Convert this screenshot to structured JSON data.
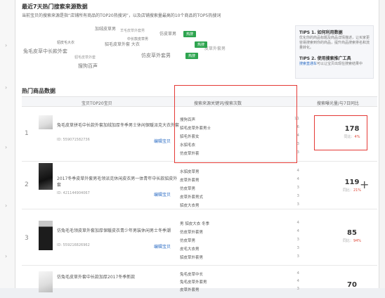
{
  "section1": {
    "title": "最近7天热门搜索来源数据",
    "desc": "当前宝贝的搜索来源是指“店铺所有商品的TOP20热搜词”，以及店铺搜索量最高的10个商品的TOP5热搜词"
  },
  "cloud_words": [
    {
      "text": "加绒皮草男",
      "size": 6
    },
    {
      "text": "貂皮毛大衣",
      "size": 5
    },
    {
      "text": "中长款皮草男",
      "size": 5
    },
    {
      "text": "貂毛皮草外套 大衣",
      "size": 6
    },
    {
      "text": "仿皮草男",
      "size": 6
    },
    {
      "text": "兔毛皮草中长款外套",
      "size": 7
    },
    {
      "text": "仿皮草外套男",
      "size": 7
    },
    {
      "text": "羊毛皮草外套男",
      "size": 6
    },
    {
      "text": "皮草外套男",
      "size": 6
    },
    {
      "text": "貂毛皮草外套",
      "size": 5
    },
    {
      "text": "搜狗百声",
      "size": 7
    }
  ],
  "cloud_tags": [
    "热搜",
    "热搜",
    "热搜"
  ],
  "tips": {
    "t1": "TIPS 1. 如何利用数据",
    "d1": "优化你的商品标题及商品详情描述，让买家更容易搜索到你的商品，提升商品搜索排名和流量转化。",
    "t2": "TIPS 2. 使用搜索推广工具",
    "d2_link": "搜索直通车",
    "d2": "可以让宝贝出现在搜索结果中"
  },
  "section2": {
    "title": "热门商品数据"
  },
  "table_headers": {
    "col1": "宝贝TOP20宝贝",
    "col2": "搜索来源关键词/搜索次数",
    "col3": "搜索曝光量/与7日同比"
  },
  "rows": [
    {
      "rank": "1",
      "title": "兔毛皮草拼毛中长款外套加绒加厚冬季男士休闲保暖派克大衣外套",
      "id": "ID: 559071582736",
      "link": "编辑宝贝",
      "keywords": [
        {
          "k": "搜狗百声",
          "c": "11"
        },
        {
          "k": "貂毛皮草外套男士",
          "c": "6"
        },
        {
          "k": "貂毛外套女",
          "c": "4"
        },
        {
          "k": "水貂毛衣",
          "c": "3"
        },
        {
          "k": "仿皮草外套",
          "c": "3"
        }
      ],
      "value": "178",
      "ratio_label": "同比：",
      "ratio": "4%"
    },
    {
      "rank": "2",
      "title": "2017冬季皮草外套男毛领派克休闲皮衣男一体青年中长款貂皮外套",
      "id": "ID: 421144904067",
      "link": "编辑宝贝",
      "keywords": [
        {
          "k": "水貂皮草男",
          "c": "4"
        },
        {
          "k": "皮草外套男",
          "c": "4"
        },
        {
          "k": "仿皮草男",
          "c": "3"
        },
        {
          "k": "皮草外套男式",
          "c": "3"
        },
        {
          "k": "貂皮大衣男",
          "c": "3"
        }
      ],
      "value": "119",
      "ratio_label": "同比：",
      "ratio": "21%"
    },
    {
      "rank": "3",
      "title": "仿兔毛毛领皮草外套加厚保暖皮衣青少年男装休闲男士冬季潮",
      "id": "ID: 559216826962",
      "link": "编辑宝贝",
      "keywords": [
        {
          "k": "男 貂皮大衣 冬季",
          "c": "4"
        },
        {
          "k": "仿皮草外套男",
          "c": "4"
        },
        {
          "k": "仿皮草男",
          "c": "3"
        },
        {
          "k": "皮毛大衣男",
          "c": "3"
        },
        {
          "k": "貂皮草外套男",
          "c": "3"
        }
      ],
      "value": "85",
      "ratio_label": "同比：",
      "ratio": "94%"
    },
    {
      "rank": "4",
      "title": "仿兔毛皮草外套中长款加厚2017冬季新款",
      "id": "",
      "link": "",
      "keywords": [
        {
          "k": "兔毛皮草中长",
          "c": "4"
        },
        {
          "k": "兔毛皮草外套男",
          "c": "4"
        },
        {
          "k": "皮草外套男",
          "c": "3"
        }
      ],
      "value": "70",
      "ratio_label": "",
      "ratio": ""
    }
  ]
}
